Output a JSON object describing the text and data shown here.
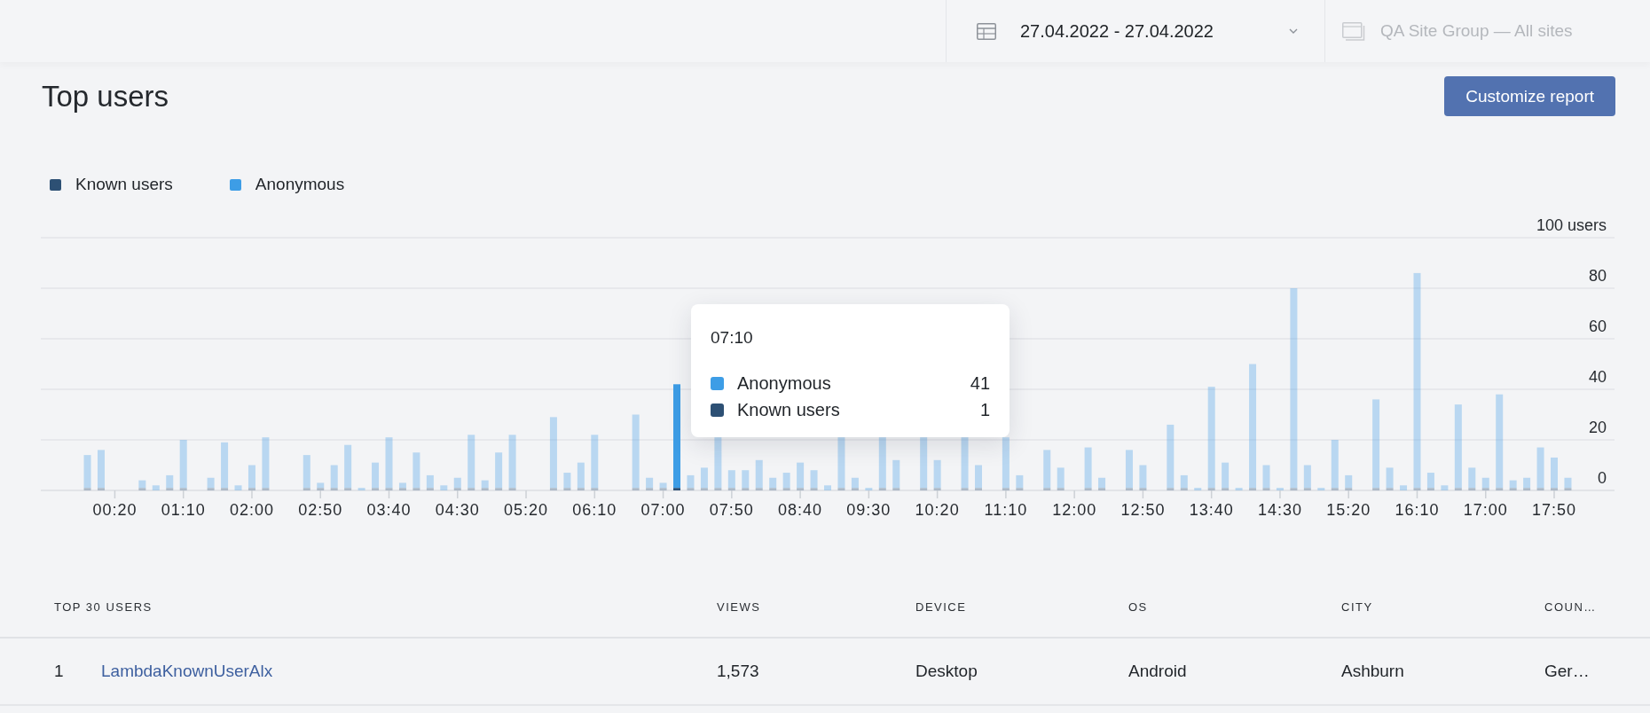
{
  "top_bar": {
    "date_range": {
      "value": "27.04.2022 - 27.04.2022"
    },
    "site_group": {
      "label": "QA Site Group — All sites",
      "disabled": true
    }
  },
  "page": {
    "title": "Top users",
    "customize_button": "Customize report"
  },
  "chart": {
    "chart_data": {
      "type": "bar",
      "stacked": true,
      "grid": true,
      "legend": "top",
      "x": [
        0,
        10,
        40,
        50,
        60,
        70,
        90,
        100,
        110,
        120,
        130,
        160,
        170,
        180,
        190,
        200,
        210,
        220,
        230,
        240,
        250,
        260,
        270,
        280,
        290,
        300,
        310,
        340,
        350,
        360,
        370,
        400,
        410,
        420,
        430,
        440,
        450,
        460,
        470,
        480,
        490,
        500,
        510,
        520,
        530,
        540,
        550,
        560,
        570,
        580,
        590,
        610,
        620,
        640,
        650,
        670,
        680,
        700,
        710,
        730,
        740,
        760,
        770,
        790,
        800,
        810,
        820,
        830,
        840,
        850,
        860,
        870,
        880,
        890,
        900,
        910,
        920,
        940,
        950,
        960,
        970,
        980,
        990,
        1000,
        1010,
        1020,
        1030,
        1040,
        1050,
        1060,
        1070,
        1080
      ],
      "series": [
        {
          "name": "Known users",
          "color": "#2d5074",
          "values": [
            1,
            1,
            1,
            0,
            1,
            1,
            1,
            1,
            0,
            1,
            1,
            1,
            1,
            1,
            1,
            0,
            1,
            1,
            1,
            1,
            1,
            0,
            1,
            1,
            1,
            1,
            1,
            1,
            1,
            1,
            1,
            1,
            1,
            1,
            1,
            1,
            1,
            1,
            1,
            1,
            1,
            1,
            1,
            1,
            1,
            0,
            1,
            1,
            0,
            1,
            1,
            1,
            1,
            1,
            1,
            1,
            1,
            1,
            1,
            1,
            1,
            1,
            1,
            1,
            1,
            0,
            1,
            1,
            0,
            1,
            1,
            0,
            1,
            1,
            0,
            1,
            1,
            1,
            1,
            0,
            1,
            1,
            0,
            1,
            1,
            1,
            1,
            1,
            1,
            1,
            1,
            1
          ]
        },
        {
          "name": "Anonymous",
          "color": "#3d9de6",
          "values": [
            13,
            15,
            3,
            2,
            5,
            19,
            4,
            18,
            2,
            9,
            20,
            13,
            2,
            9,
            17,
            1,
            10,
            20,
            2,
            14,
            5,
            2,
            4,
            21,
            3,
            14,
            21,
            28,
            6,
            10,
            21,
            29,
            4,
            2,
            41,
            5,
            8,
            20,
            7,
            7,
            11,
            4,
            6,
            10,
            7,
            2,
            20,
            4,
            1,
            20,
            11,
            20,
            11,
            20,
            9,
            20,
            5,
            15,
            8,
            16,
            4,
            15,
            9,
            25,
            5,
            1,
            40,
            10,
            1,
            49,
            9,
            1,
            79,
            9,
            1,
            19,
            5,
            35,
            8,
            2,
            85,
            6,
            2,
            33,
            8,
            4,
            37,
            3,
            4,
            16,
            12,
            4
          ]
        }
      ],
      "xlim": [
        -34,
        1114
      ],
      "ylim": [
        0,
        100
      ],
      "yticks": [
        0,
        20,
        40,
        60,
        80,
        {
          "value": 100,
          "label": "100 users"
        }
      ],
      "xticks": [
        {
          "value": 20,
          "label": "00:20"
        },
        {
          "value": 70,
          "label": "01:10"
        },
        {
          "value": 120,
          "label": "02:00"
        },
        {
          "value": 170,
          "label": "02:50"
        },
        {
          "value": 220,
          "label": "03:40"
        },
        {
          "value": 270,
          "label": "04:30"
        },
        {
          "value": 320,
          "label": "05:20"
        },
        {
          "value": 370,
          "label": "06:10"
        },
        {
          "value": 420,
          "label": "07:00"
        },
        {
          "value": 470,
          "label": "07:50"
        },
        {
          "value": 520,
          "label": "08:40"
        },
        {
          "value": 570,
          "label": "09:30"
        },
        {
          "value": 620,
          "label": "10:20"
        },
        {
          "value": 670,
          "label": "11:10"
        },
        {
          "value": 720,
          "label": "12:00"
        },
        {
          "value": 770,
          "label": "12:50"
        },
        {
          "value": 820,
          "label": "13:40"
        },
        {
          "value": 870,
          "label": "14:30"
        },
        {
          "value": 920,
          "label": "15:20"
        },
        {
          "value": 970,
          "label": "16:10"
        },
        {
          "value": 1020,
          "label": "17:00"
        },
        {
          "value": 1070,
          "label": "17:50"
        }
      ]
    },
    "tooltip": {
      "title": "07:10",
      "rows": [
        {
          "label": "Anonymous",
          "value": "41",
          "color": "#3d9de6"
        },
        {
          "label": "Known users",
          "value": "1",
          "color": "#2d5074"
        }
      ]
    }
  },
  "table": {
    "columns": [
      "TOP 30 USERS",
      "VIEWS",
      "DEVICE",
      "OS",
      "CITY",
      "COUN…"
    ],
    "rows": [
      {
        "rank": "1",
        "cells": [
          "LambdaKnownUserAlx",
          "1,573",
          "Desktop",
          "Android",
          "Ashburn",
          "Ger…"
        ]
      }
    ]
  }
}
